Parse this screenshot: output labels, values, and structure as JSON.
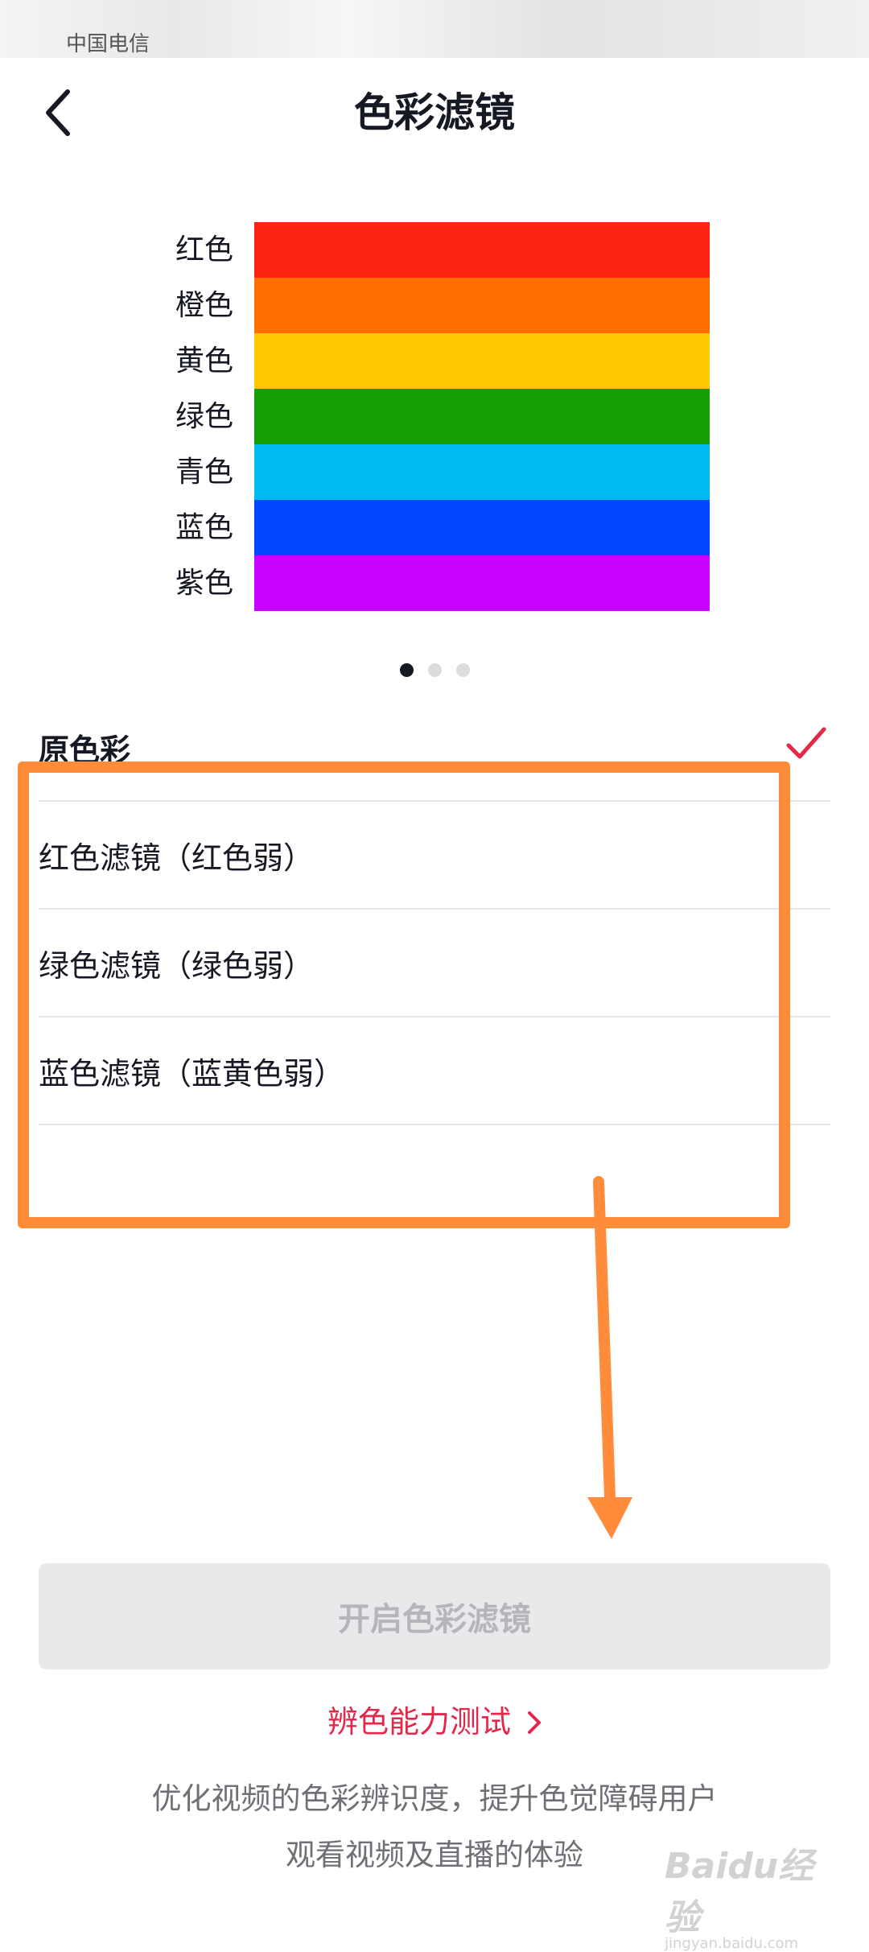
{
  "status_bar": {
    "carrier": "中国电信"
  },
  "header": {
    "title": "色彩滤镜",
    "back_icon": "chevron-left-icon"
  },
  "demo": {
    "labels": [
      "红色",
      "橙色",
      "黄色",
      "绿色",
      "青色",
      "蓝色",
      "紫色"
    ],
    "colors": [
      "#ff2314",
      "#ff6e00",
      "#ffc800",
      "#14a005",
      "#00bbf0",
      "#0046ff",
      "#c800ff"
    ]
  },
  "pager": {
    "count": 3,
    "active": 1
  },
  "options": [
    {
      "label": "原色彩",
      "selected": true
    },
    {
      "label": "红色滤镜（红色弱）",
      "selected": false
    },
    {
      "label": "绿色滤镜（绿色弱）",
      "selected": false
    },
    {
      "label": "蓝色滤镜（蓝黄色弱）",
      "selected": false
    }
  ],
  "enable_button": {
    "label": "开启色彩滤镜"
  },
  "test_link": {
    "label": "辨色能力测试"
  },
  "description": {
    "line1": "优化视频的色彩辨识度，提升色觉障碍用户",
    "line2": "观看视频及直播的体验"
  },
  "watermark": {
    "text": "Baidu经验",
    "sub": "jingyan.baidu.com"
  },
  "colors": {
    "accent": "#e4284a",
    "annotation": "#ff8c3a"
  }
}
